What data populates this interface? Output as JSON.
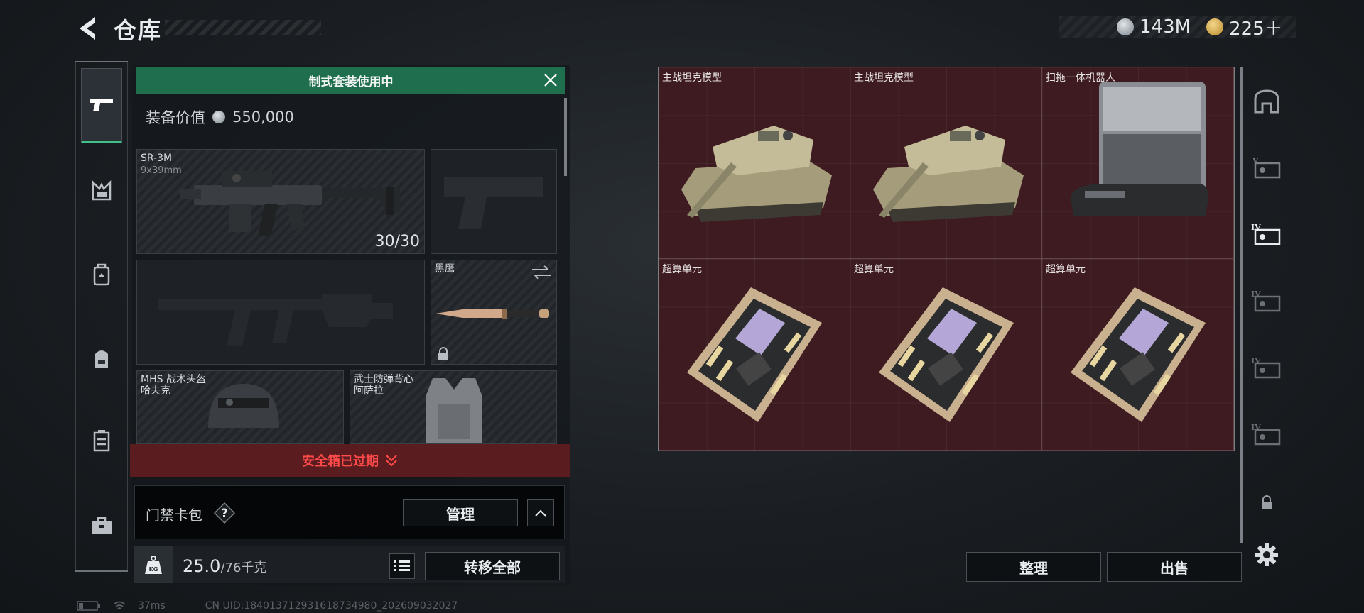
{
  "header": {
    "title": "仓库",
    "currency": [
      {
        "icon": "silver-coin-icon",
        "value": "143M"
      },
      {
        "icon": "gold-triangle-coin-icon",
        "value": "225＋"
      }
    ]
  },
  "left_rail": {
    "items": [
      {
        "icon": "pistol-icon",
        "active": true
      },
      {
        "icon": "chest-rig-icon"
      },
      {
        "icon": "backpack-icon"
      },
      {
        "icon": "rucksack-icon"
      },
      {
        "icon": "container-icon"
      },
      {
        "icon": "briefcase-icon"
      }
    ]
  },
  "loadout": {
    "banner": "制式套装使用中",
    "value_label": "装备价值",
    "value": "550,000",
    "primary": {
      "name": "SR-3M",
      "caliber": "9x39mm",
      "ammo": "30/30"
    },
    "melee": {
      "name": "黑鹰"
    },
    "helmet": {
      "name": "MHS 战术头盔",
      "sub": "哈夫克"
    },
    "armor": {
      "name": "武士防弹背心",
      "sub": "阿萨拉"
    }
  },
  "safebox": {
    "text": "安全箱已过期"
  },
  "keycard": {
    "label": "门禁卡包",
    "help": "?",
    "manage": "管理"
  },
  "bottom": {
    "weight_value": "25.0",
    "weight_max": "/76千克",
    "transfer": "转移全部"
  },
  "storage": {
    "items": [
      {
        "name": "主战坦克模型",
        "type": "tank"
      },
      {
        "name": "主战坦克模型",
        "type": "tank"
      },
      {
        "name": "扫拖一体机器人",
        "type": "robot"
      },
      {
        "name": "超算单元",
        "type": "board"
      },
      {
        "name": "超算单元",
        "type": "board"
      },
      {
        "name": "超算单元",
        "type": "board"
      }
    ],
    "sort": "整理",
    "sell": "出售"
  },
  "status": {
    "ping": "37ms",
    "uid": "CN UID:18401371293161873498­0_202609032027"
  }
}
